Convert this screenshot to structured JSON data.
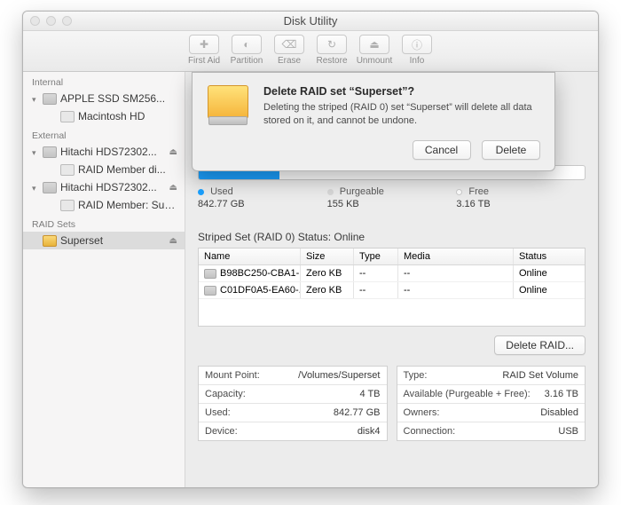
{
  "app_title": "Disk Utility",
  "toolbar": [
    {
      "name": "first-aid",
      "label": "First Aid",
      "glyph": "✚"
    },
    {
      "name": "partition",
      "label": "Partition",
      "glyph": "◐"
    },
    {
      "name": "erase",
      "label": "Erase",
      "glyph": "⌫"
    },
    {
      "name": "restore",
      "label": "Restore",
      "glyph": "↻"
    },
    {
      "name": "unmount",
      "label": "Unmount",
      "glyph": "⏏"
    },
    {
      "name": "info",
      "label": "Info",
      "glyph": "ⓘ"
    }
  ],
  "sidebar": {
    "sections": {
      "internal": "Internal",
      "external": "External",
      "raid_sets": "RAID Sets"
    },
    "internal": [
      {
        "name": "APPLE SSD SM256...",
        "children": [
          {
            "name": "Macintosh HD"
          }
        ]
      }
    ],
    "external": [
      {
        "name": "Hitachi HDS72302...",
        "children": [
          {
            "name": "RAID Member di..."
          }
        ]
      },
      {
        "name": "Hitachi HDS72302...",
        "children": [
          {
            "name": "RAID Member: Sup..."
          }
        ]
      }
    ],
    "raid_sets": [
      {
        "name": "Superset",
        "selected": true
      }
    ]
  },
  "usage": {
    "legend": {
      "used": "Used",
      "purgeable": "Purgeable",
      "free": "Free"
    },
    "used": {
      "value": "842.77 GB",
      "color": "#1ba1ff"
    },
    "purgeable": {
      "value": "155 KB",
      "color": "#d8d8d8"
    },
    "free": {
      "value": "3.16 TB",
      "color": "#ffffff"
    },
    "used_pct": 21
  },
  "status_line": "Striped Set (RAID 0) Status: Online",
  "table": {
    "headers": {
      "name": "Name",
      "size": "Size",
      "type": "Type",
      "media": "Media",
      "status": "Status"
    },
    "rows": [
      {
        "name": "B98BC250-CBA1-...",
        "size": "Zero KB",
        "type": "--",
        "media": "--",
        "status": "Online"
      },
      {
        "name": "C01DF0A5-EA60-...",
        "size": "Zero KB",
        "type": "--",
        "media": "--",
        "status": "Online"
      }
    ]
  },
  "delete_raid_button": "Delete RAID...",
  "info_left": [
    {
      "k": "Mount Point:",
      "v": "/Volumes/Superset"
    },
    {
      "k": "Capacity:",
      "v": "4 TB"
    },
    {
      "k": "Used:",
      "v": "842.77 GB"
    },
    {
      "k": "Device:",
      "v": "disk4"
    }
  ],
  "info_right": [
    {
      "k": "Type:",
      "v": "RAID Set Volume"
    },
    {
      "k": "Available (Purgeable + Free):",
      "v": "3.16 TB"
    },
    {
      "k": "Owners:",
      "v": "Disabled"
    },
    {
      "k": "Connection:",
      "v": "USB"
    }
  ],
  "dialog": {
    "title": "Delete RAID set “Superset”?",
    "message": "Deleting the striped (RAID 0) set “Superset” will delete all data stored on it, and cannot be undone.",
    "cancel": "Cancel",
    "confirm": "Delete"
  }
}
